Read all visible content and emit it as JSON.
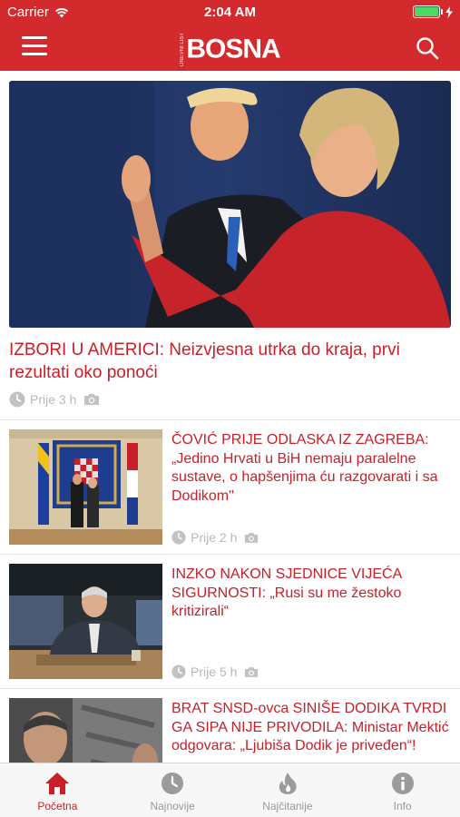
{
  "status_bar": {
    "carrier": "Carrier",
    "time": "2:04 AM"
  },
  "header": {
    "logo_small": "DNEVNI LIST",
    "logo": "BOSNA",
    "brand_color": "#d32a2e"
  },
  "hero": {
    "title": "IZBORI U AMERICI: Neizvjesna utrka do kraja, prvi rezultati oko ponoći",
    "time": "Prije 3 h"
  },
  "articles": [
    {
      "title": "ČOVIĆ PRIJE ODLASKA IZ ZAGREBA: „Jedino Hrvati u BiH nemaju paralelne sustave, o hapšenjima ću razgovarati i sa Dodikom\"",
      "time": "Prije 2 h"
    },
    {
      "title": "INZKO NAKON SJEDNICE VIJEĆA SIGURNOSTI: „Rusi su me žestoko kritizirali“",
      "time": "Prije 5 h"
    },
    {
      "title": "BRAT SNSD-ovca SINIŠE DODIKA TVRDI GA SIPA NIJE PRIVODILA: Ministar Mektić odgovara: „Ljubiša Dodik je priveđen“!",
      "time": ""
    }
  ],
  "tabs": [
    {
      "label": "Početna",
      "icon": "home-icon",
      "active": true
    },
    {
      "label": "Najnovije",
      "icon": "clock-icon",
      "active": false
    },
    {
      "label": "Najčitanije",
      "icon": "flame-icon",
      "active": false
    },
    {
      "label": "Info",
      "icon": "info-icon",
      "active": false
    }
  ],
  "colors": {
    "accent": "#c8202a",
    "meta_gray": "#b8b8b8",
    "tab_inactive": "#999999"
  }
}
